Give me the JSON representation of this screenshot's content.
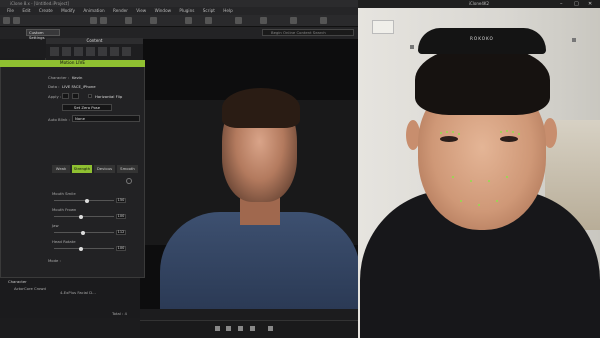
{
  "app": {
    "title": "iClone 8.x - [Untitled.iProject]",
    "menu": [
      "File",
      "Edit",
      "Create",
      "Modify",
      "Animation",
      "Render",
      "View",
      "Window",
      "Plugins",
      "Script",
      "Help"
    ],
    "toolbar": {
      "custom_settings": "Custom Settings",
      "search_placeholder": "Begin Online Content Search"
    },
    "content_panel": {
      "title": "Content"
    },
    "left_panel": {
      "header_label": "Connection",
      "actions_label": "Actions",
      "ip_value": "1.33.02.098",
      "body_label": "Body",
      "hand_label": "Hand"
    },
    "motion_live": {
      "title": "Motion LIVE",
      "character_label": "Character :",
      "character_value": "Kevin",
      "data_label": "Data :",
      "data_value": "LIVE FACE_iPhone",
      "apply_label": "Apply :",
      "horizontal_flip": "Horizontal Flip",
      "set_zero_pose": "Set Zero Pose",
      "auto_blink_label": "Auto Blink :",
      "auto_blink_value": "None",
      "tabs": [
        "Weak",
        "Strength",
        "Devious",
        "Smooth"
      ],
      "active_tab": "Strength",
      "sliders": [
        {
          "label": "Mouth Smile",
          "value": "150",
          "level": 0.55
        },
        {
          "label": "Mouth Frown",
          "value": "100",
          "level": 0.45
        },
        {
          "label": "Jaw",
          "value": "112",
          "level": 0.48
        },
        {
          "label": "Head Rotate",
          "value": "100",
          "level": 0.45
        }
      ],
      "mode_label": "Mode :"
    },
    "bottom": {
      "character_label": "Character",
      "actorcore_label": "ActorCore Crowd",
      "faceplus_label": "4-ExPlus Facial D...",
      "total_label": "Total : 4"
    }
  },
  "camera_window": {
    "title": "iClone4K2",
    "headband_brand": "ROKOKO",
    "window_controls": [
      "minimize",
      "maximize",
      "close"
    ]
  },
  "colors": {
    "accent_green": "#8fc031",
    "panel_bg": "#222224",
    "app_bg": "#1c1c1e"
  }
}
